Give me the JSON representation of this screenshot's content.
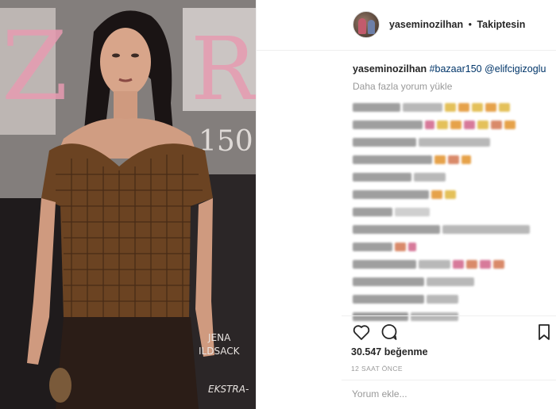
{
  "post": {
    "username": "yaseminozilhan",
    "separator": "•",
    "follow_status": "Takiptesin"
  },
  "caption": {
    "username": "yaseminozilhan",
    "hashtag": "#bazaar150",
    "mention": "@elifcigizoglu"
  },
  "comments": {
    "load_more": "Daha fazla yorum yükle"
  },
  "actions": {
    "like_icon": "heart-icon",
    "comment_icon": "comment-bubble-icon",
    "save_icon": "bookmark-icon"
  },
  "stats": {
    "likes_text": "30.547 beğenme",
    "timestamp": "12 SAAT ÖNCE"
  },
  "comment_input": {
    "placeholder": "Yorum ekle..."
  },
  "photo": {
    "cover_text_left": "Z",
    "cover_text_right": "R"
  },
  "colors": {
    "link": "#003569",
    "muted": "#999999",
    "border": "#efefef",
    "cover_pink": "#e89ab0"
  }
}
